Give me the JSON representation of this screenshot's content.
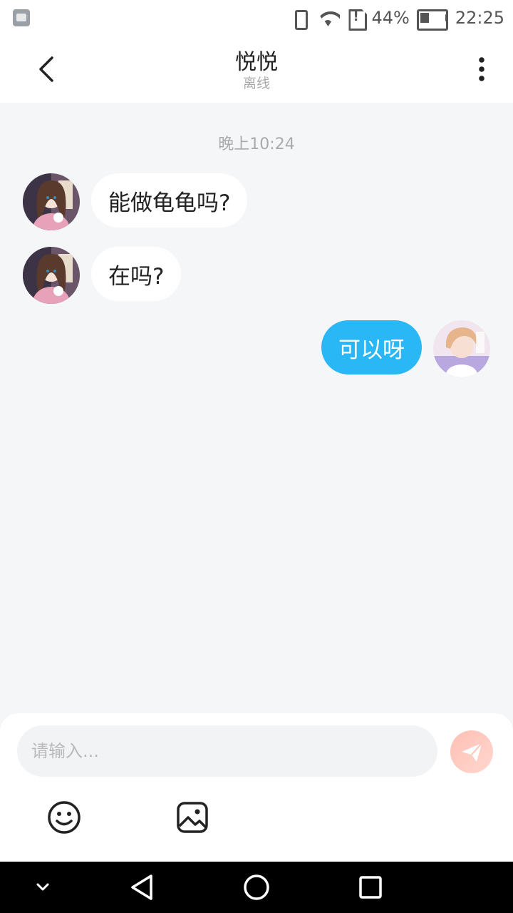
{
  "status_bar": {
    "battery_percent_text": "44%",
    "battery_level": 0.44,
    "time": "22:25",
    "icons": [
      "gallery-notification-icon",
      "vibrate-icon",
      "wifi-icon",
      "sim-alert-icon",
      "battery-icon"
    ]
  },
  "header": {
    "title": "悦悦",
    "subtitle": "离线",
    "back_icon": "chevron-left-icon",
    "more_icon": "more-vertical-icon"
  },
  "chat": {
    "time_label": "晚上10:24",
    "messages": [
      {
        "direction": "in",
        "text": "能做龟龟吗?"
      },
      {
        "direction": "in",
        "text": "在吗?"
      },
      {
        "direction": "out",
        "text": "可以呀"
      }
    ]
  },
  "composer": {
    "placeholder": "请输入...",
    "value": "",
    "send_icon": "send-icon",
    "tools": [
      "emoji-icon",
      "image-icon"
    ]
  },
  "colors": {
    "accent": "#29b7f6",
    "background": "#f5f6f8",
    "send_button": "#ff8a7a"
  },
  "nav_bar": {
    "icons": [
      "chevron-down-icon",
      "back-triangle-icon",
      "home-circle-icon",
      "recents-square-icon"
    ]
  }
}
